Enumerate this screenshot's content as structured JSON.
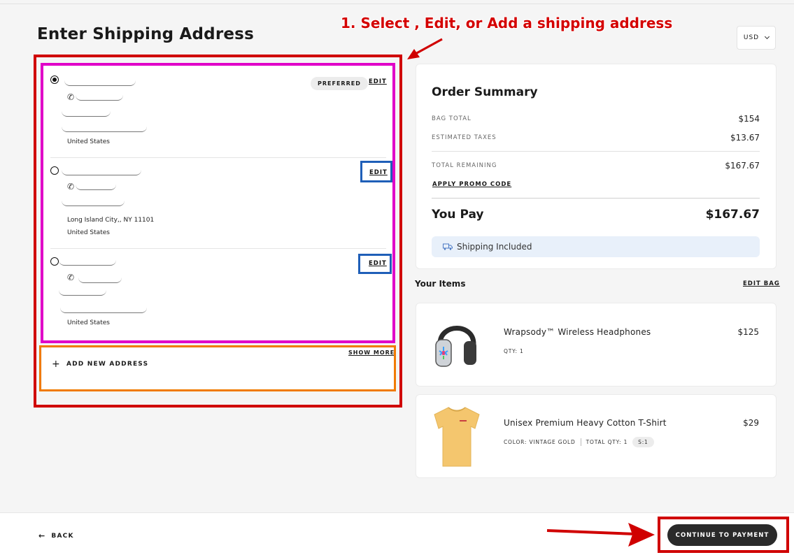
{
  "page": {
    "title": "Enter Shipping Address",
    "annotation": "1. Select , Edit, or Add a shipping address",
    "currency": "USD"
  },
  "addresses": [
    {
      "selected": true,
      "badge": "PREFERRED",
      "edit": "EDIT",
      "city": "",
      "country": "United States"
    },
    {
      "selected": false,
      "badge": "",
      "edit": "EDIT",
      "city": "Long Island City,, NY 11101",
      "country": "United States"
    },
    {
      "selected": false,
      "badge": "",
      "edit": "EDIT",
      "city": "",
      "country": "United States"
    }
  ],
  "address_actions": {
    "show_more": "SHOW MORE",
    "add_new": "ADD NEW ADDRESS"
  },
  "summary": {
    "title": "Order Summary",
    "bag_total_label": "BAG TOTAL",
    "bag_total": "$154",
    "taxes_label": "ESTIMATED TAXES",
    "taxes": "$13.67",
    "remaining_label": "TOTAL REMAINING",
    "remaining": "$167.67",
    "promo": "APPLY PROMO CODE",
    "you_pay_label": "You Pay",
    "you_pay": "$167.67",
    "shipping": "Shipping Included"
  },
  "items_section": {
    "title": "Your Items",
    "edit_bag": "EDIT BAG"
  },
  "items": [
    {
      "name": "Wrapsody™ Wireless Headphones",
      "price": "$125",
      "qty": "QTY: 1",
      "icon": "headphones-image"
    },
    {
      "name": "Unisex Premium Heavy Cotton T-Shirt",
      "price": "$29",
      "color": "COLOR: VINTAGE GOLD",
      "total_qty": "TOTAL QTY: 1",
      "size": "S:1",
      "icon": "tshirt-image"
    }
  ],
  "footer": {
    "back": "BACK",
    "continue": "CONTINUE TO PAYMENT"
  },
  "colors": {
    "annotation_red": "#d00000",
    "frame_magenta": "#e000c8",
    "frame_orange": "#f07a00",
    "frame_blue": "#1f5fb8",
    "cta_dark": "#2a2a2a",
    "shipping_bg": "#e8f0fa"
  }
}
